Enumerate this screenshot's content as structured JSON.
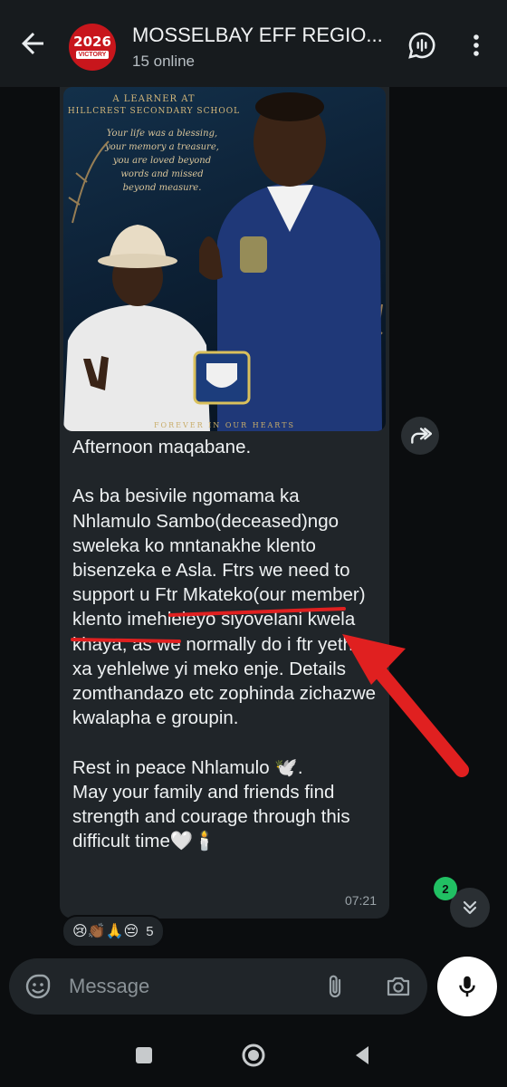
{
  "header": {
    "title": "MOSSELBAY EFF REGIO...",
    "status": "15 online",
    "avatar": {
      "year_left": "2",
      "year_mid": "0",
      "year_right": "6",
      "banner": "VICTORY"
    }
  },
  "photo": {
    "line1": "A LEARNER AT",
    "line2": "HILLCREST SECONDARY SCHOOL",
    "poem": "Your life was a blessing, your memory a treasure, you are loved beyond words and missed beyond measure.",
    "footer": "FOREVER IN OUR HEARTS"
  },
  "message": {
    "text": "Afternoon maqabane.\n\nAs ba besivile ngomama ka Nhlamulo Sambo(deceased)ngo sweleka ko mntanakhe klento bisenzeka e Asla. Ftrs we need to support u Ftr Mkateko(our member) klento imehleleyo siyovelani kwela khaya, as we normally do i ftr yethu xa yehlelwe yi meko enje. Details zomthandazo etc zophinda zichazwe kwalapha e groupin.\n\nRest in peace Nhlamulo 🕊️.\nMay your family and friends find strength and courage through this difficult time🤍🕯️",
    "time": "07:21"
  },
  "reactions": {
    "emojis": "😢👏🏾🙏😔",
    "count": "5"
  },
  "scroll": {
    "unread": "2"
  },
  "composer": {
    "placeholder": "Message"
  },
  "colors": {
    "accent": "#21c063",
    "bubble": "#202529",
    "annotation": "#e02020"
  },
  "icons": [
    "back-arrow-icon",
    "group-avatar",
    "voice-chat-icon",
    "more-vert-icon",
    "forward-icon",
    "chevron-double-down-icon",
    "sticker-icon",
    "attach-icon",
    "camera-icon",
    "mic-icon",
    "nav-square-icon",
    "nav-circle-icon",
    "nav-back-icon"
  ]
}
